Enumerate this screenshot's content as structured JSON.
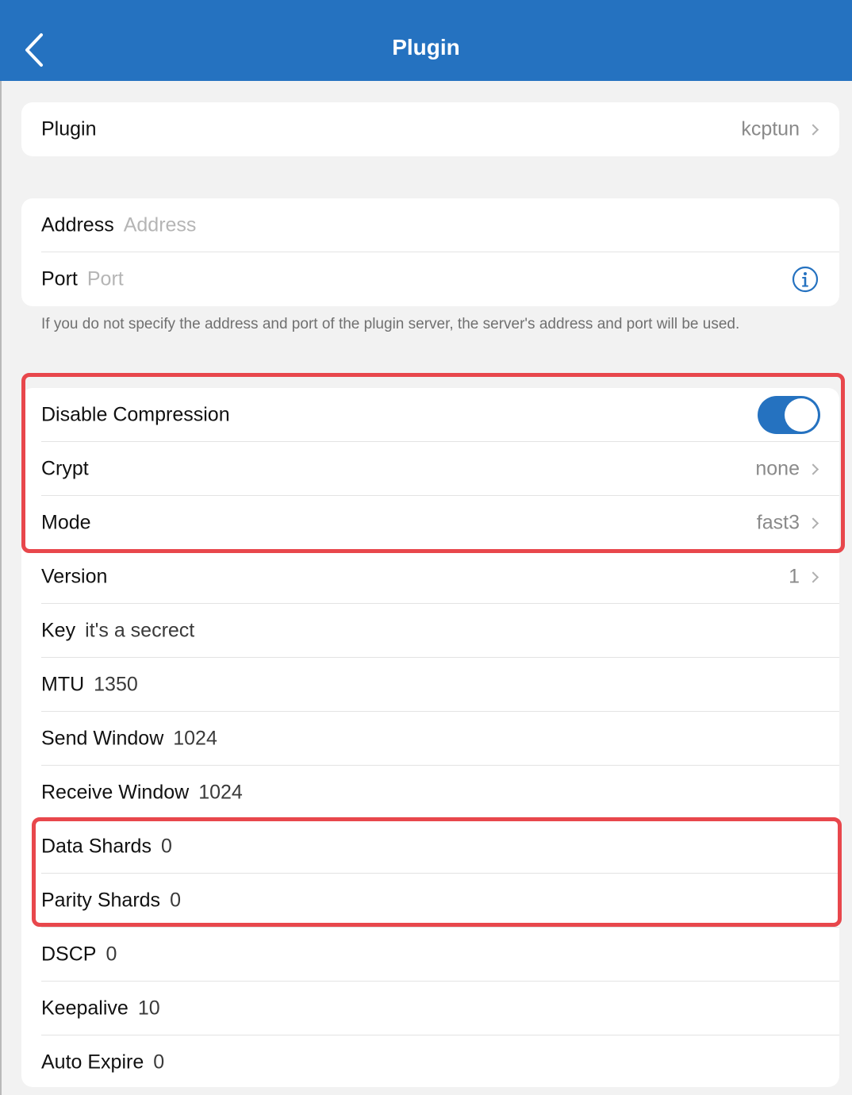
{
  "header": {
    "title": "Plugin"
  },
  "plugin_row": {
    "label": "Plugin",
    "value": "kcptun"
  },
  "server": {
    "address_label": "Address",
    "address_placeholder": "Address",
    "port_label": "Port",
    "port_placeholder": "Port",
    "footnote": "If you do not specify the address and port of the plugin server, the server's address and port will be used."
  },
  "options": {
    "disable_compression": {
      "label": "Disable Compression",
      "enabled": true
    },
    "crypt": {
      "label": "Crypt",
      "value": "none"
    },
    "mode": {
      "label": "Mode",
      "value": "fast3"
    },
    "version": {
      "label": "Version",
      "value": "1"
    },
    "key": {
      "label": "Key",
      "value": "it's a secrect"
    },
    "mtu": {
      "label": "MTU",
      "value": "1350"
    },
    "send_window": {
      "label": "Send Window",
      "value": "1024"
    },
    "receive_window": {
      "label": "Receive Window",
      "value": "1024"
    },
    "data_shards": {
      "label": "Data Shards",
      "value": "0"
    },
    "parity_shards": {
      "label": "Parity Shards",
      "value": "0"
    },
    "dscp": {
      "label": "DSCP",
      "value": "0"
    },
    "keepalive": {
      "label": "Keepalive",
      "value": "10"
    },
    "auto_expire": {
      "label": "Auto Expire",
      "value": "0"
    }
  },
  "icons": {
    "back": "chevron-left-icon",
    "info": "info-icon",
    "chevron": "chevron-right-icon"
  },
  "colors": {
    "accent": "#2572c0",
    "highlight": "#e8474c"
  }
}
